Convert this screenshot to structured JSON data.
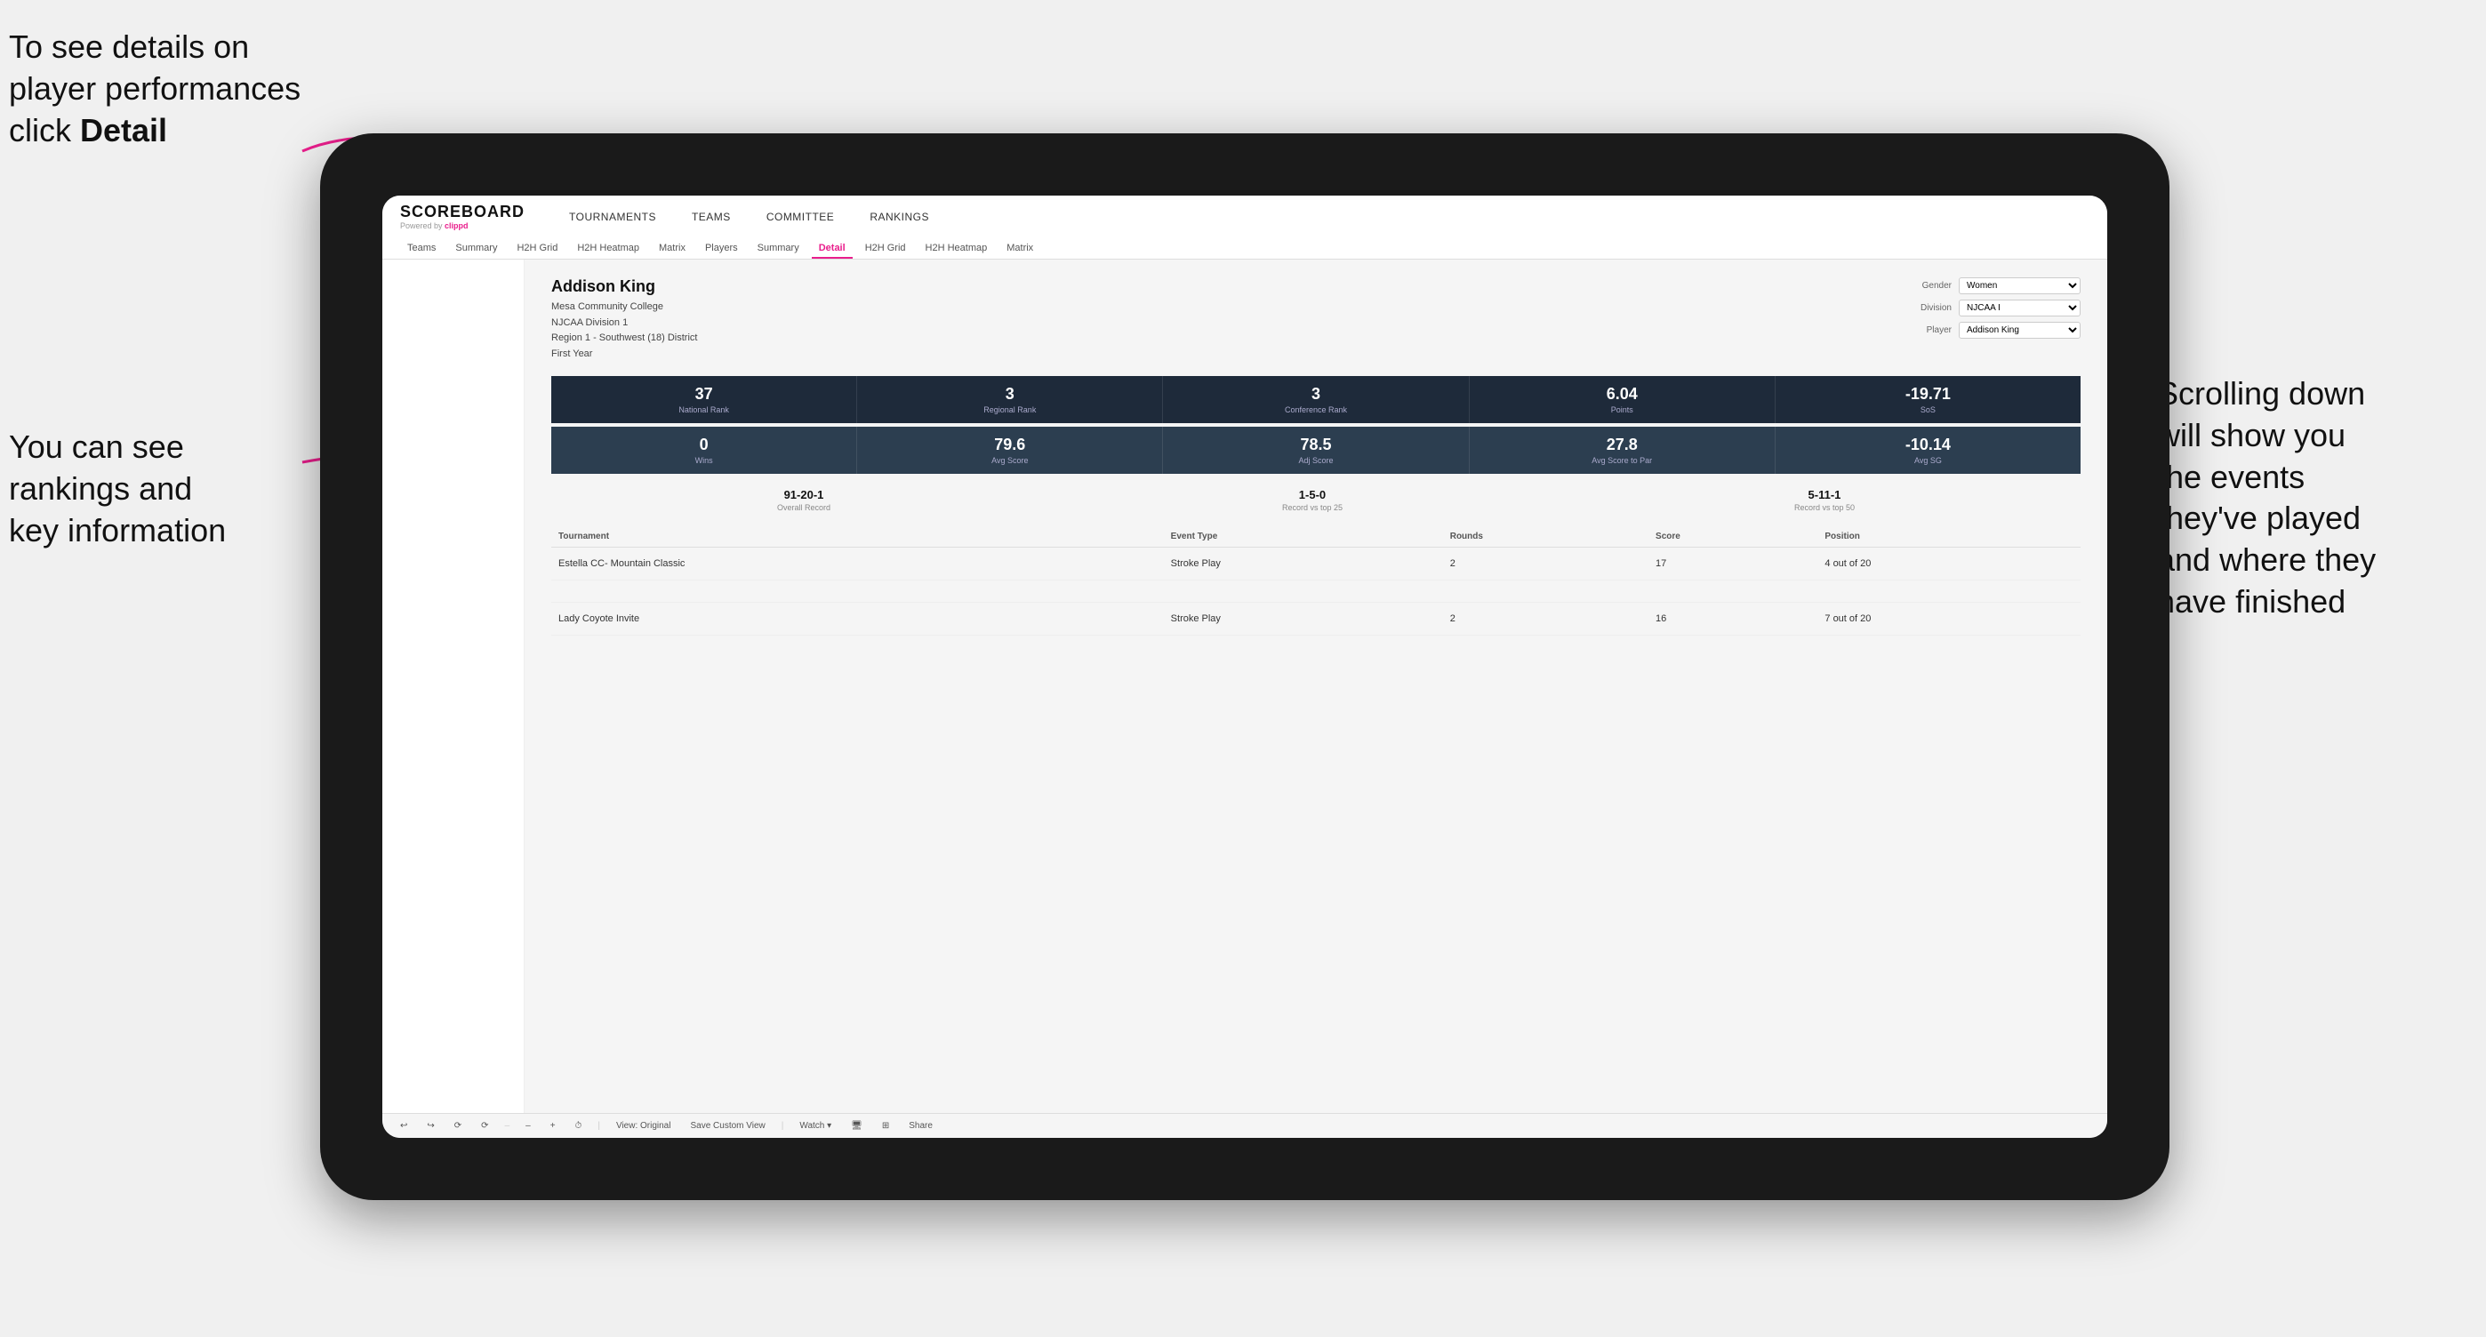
{
  "annotations": {
    "top_left": "To see details on player performances click ",
    "top_left_bold": "Detail",
    "bottom_left_line1": "You can see",
    "bottom_left_line2": "rankings and",
    "bottom_left_line3": "key information",
    "right_line1": "Scrolling down",
    "right_line2": "will show you",
    "right_line3": "the events",
    "right_line4": "they've played",
    "right_line5": "and where they",
    "right_line6": "have finished"
  },
  "nav": {
    "logo": "SCOREBOARD",
    "powered_by": "Powered by",
    "clippd": "clippd",
    "items": [
      "TOURNAMENTS",
      "TEAMS",
      "COMMITTEE",
      "RANKINGS"
    ],
    "sub_items": [
      "Teams",
      "Summary",
      "H2H Grid",
      "H2H Heatmap",
      "Matrix",
      "Players",
      "Summary",
      "Detail",
      "H2H Grid",
      "H2H Heatmap",
      "Matrix"
    ],
    "active_sub": "Detail"
  },
  "player": {
    "name": "Addison King",
    "school": "Mesa Community College",
    "division": "NJCAA Division 1",
    "region": "Region 1 - Southwest (18) District",
    "year": "First Year",
    "gender_label": "Gender",
    "gender_value": "Women",
    "division_label": "Division",
    "division_value": "NJCAA I",
    "player_label": "Player",
    "player_value": "Addison King"
  },
  "stats_row1": [
    {
      "value": "37",
      "label": "National Rank"
    },
    {
      "value": "3",
      "label": "Regional Rank"
    },
    {
      "value": "3",
      "label": "Conference Rank"
    },
    {
      "value": "6.04",
      "label": "Points"
    },
    {
      "value": "-19.71",
      "label": "SoS"
    }
  ],
  "stats_row2": [
    {
      "value": "0",
      "label": "Wins"
    },
    {
      "value": "79.6",
      "label": "Avg Score"
    },
    {
      "value": "78.5",
      "label": "Adj Score"
    },
    {
      "value": "27.8",
      "label": "Avg Score to Par"
    },
    {
      "value": "-10.14",
      "label": "Avg SG"
    }
  ],
  "records": [
    {
      "value": "91-20-1",
      "label": "Overall Record"
    },
    {
      "value": "1-5-0",
      "label": "Record vs top 25"
    },
    {
      "value": "5-11-1",
      "label": "Record vs top 50"
    }
  ],
  "table": {
    "headers": [
      "Tournament",
      "Event Type",
      "Rounds",
      "Score",
      "Position"
    ],
    "rows": [
      {
        "tournament": "Estella CC- Mountain Classic",
        "event_type": "Stroke Play",
        "rounds": "2",
        "score": "17",
        "position": "4 out of 20"
      },
      {
        "tournament": "",
        "event_type": "",
        "rounds": "",
        "score": "",
        "position": ""
      },
      {
        "tournament": "Lady Coyote Invite",
        "event_type": "Stroke Play",
        "rounds": "2",
        "score": "16",
        "position": "7 out of 20"
      }
    ]
  },
  "toolbar": {
    "buttons": [
      "↩",
      "↪",
      "⟳",
      "⟳",
      "–",
      "+",
      "⏱",
      "View: Original",
      "Save Custom View",
      "Watch ▾",
      "🖥",
      "⊞",
      "Share"
    ]
  }
}
